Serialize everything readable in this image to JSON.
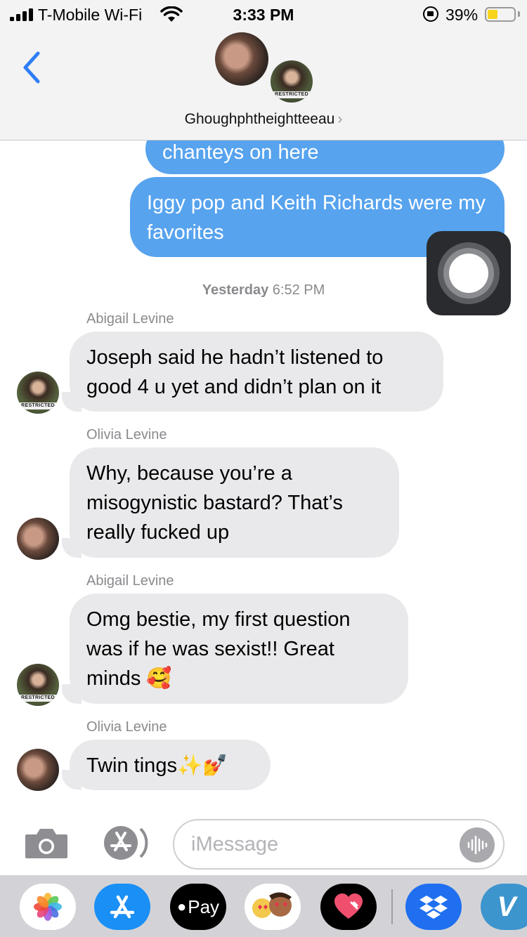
{
  "status_bar": {
    "carrier": "T-Mobile Wi-Fi",
    "time": "3:33 PM",
    "battery_percent": "39%",
    "battery_level": 0.39
  },
  "header": {
    "contact_name": "Ghoughphtheightteeau",
    "chevron": "›",
    "avatar_badge_text": "RESTRICTED"
  },
  "messages": {
    "outgoing": [
      {
        "text": "chanteys on here"
      },
      {
        "text": "Iggy pop and Keith Richards were my favorites"
      }
    ],
    "timestamp_day": "Yesterday",
    "timestamp_time": "6:52 PM",
    "incoming": [
      {
        "sender": "Abigail Levine",
        "text": "Joseph said he hadn’t listened to good 4 u yet and didn’t plan on it"
      },
      {
        "sender": "Olivia Levine",
        "text": "Why, because you’re a misogynistic bastard? That’s really fucked up"
      },
      {
        "sender": "Abigail Levine",
        "text": "Omg bestie, my first question was if he was sexist!! Great minds 🥰"
      },
      {
        "sender": "Olivia Levine",
        "text": "Twin tings✨💅"
      }
    ]
  },
  "input": {
    "placeholder": "iMessage"
  },
  "app_drawer": {
    "apple_pay_label": "Pay",
    "venmo_label": "V"
  }
}
